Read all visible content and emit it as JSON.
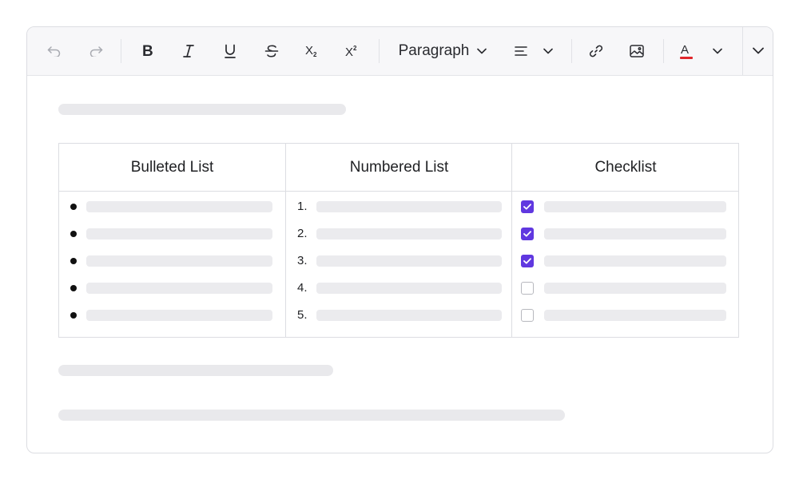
{
  "toolbar": {
    "paragraph_label": "Paragraph",
    "text_color_accent": "#e0262b",
    "buttons": [
      "undo-icon",
      "redo-icon",
      "bold-icon",
      "italic-icon",
      "underline-icon",
      "strikethrough-icon",
      "subscript-icon",
      "superscript-icon",
      "align-icon",
      "link-icon",
      "image-icon",
      "text-color-icon",
      "more-icon"
    ]
  },
  "table": {
    "headers": [
      "Bulleted List",
      "Numbered List",
      "Checklist"
    ],
    "numbered": [
      "1.",
      "2.",
      "3.",
      "4.",
      "5."
    ],
    "checklist": [
      true,
      true,
      true,
      false,
      false
    ]
  },
  "colors": {
    "checkbox_checked": "#6038e0",
    "skeleton": "#e9e9ec"
  }
}
